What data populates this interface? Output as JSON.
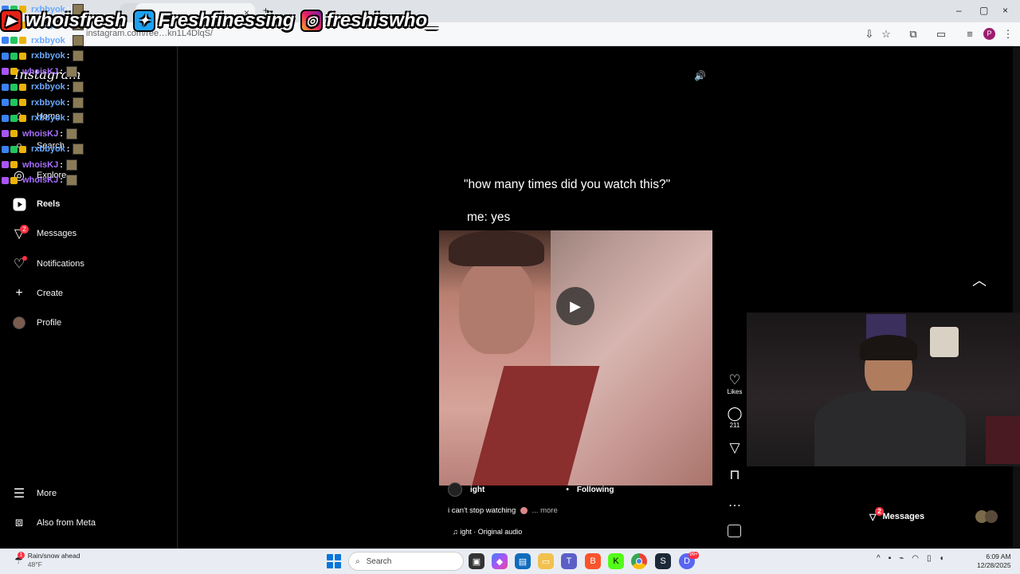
{
  "browser": {
    "tab_close": "×",
    "new_tab": "+",
    "url": "instagram.com/ree…kn1L4DlqS/",
    "window_controls": [
      "–",
      "▢",
      "×"
    ]
  },
  "overlay": {
    "socials": [
      {
        "icon": "youtube-icon",
        "handle": "whoisfresh"
      },
      {
        "icon": "twitter-icon",
        "handle": "Freshfinessing"
      },
      {
        "icon": "instagram-icon",
        "handle": "freshiswho_"
      }
    ],
    "chat": [
      {
        "name": "rxbbyok",
        "color": "blue"
      },
      {
        "name": "rxbbyok",
        "color": "blue"
      },
      {
        "name": "rxbbyok",
        "color": "blue"
      },
      {
        "name": "rxbbyok",
        "color": "blue"
      },
      {
        "name": "whoisKJ",
        "color": "purple"
      },
      {
        "name": "rxbbyok",
        "color": "blue"
      },
      {
        "name": "rxbbyok",
        "color": "blue"
      },
      {
        "name": "rxbbyok",
        "color": "blue"
      },
      {
        "name": "whoisKJ",
        "color": "purple"
      },
      {
        "name": "rxbbyok",
        "color": "blue"
      },
      {
        "name": "whoisKJ",
        "color": "purple"
      },
      {
        "name": "whoisKJ",
        "color": "purple"
      }
    ],
    "chat_colon": ":"
  },
  "sidebar": {
    "logo": "Instagram",
    "items": [
      {
        "label": "Home",
        "icon": "home-icon"
      },
      {
        "label": "Search",
        "icon": "search-icon"
      },
      {
        "label": "Explore",
        "icon": "compass-icon"
      },
      {
        "label": "Reels",
        "icon": "reels-icon"
      },
      {
        "label": "Messages",
        "icon": "messages-icon",
        "badge": "2"
      },
      {
        "label": "Notifications",
        "icon": "heart-icon"
      },
      {
        "label": "Create",
        "icon": "plus-icon"
      },
      {
        "label": "Profile",
        "icon": "avatar"
      }
    ],
    "bottom": [
      {
        "label": "More",
        "icon": "menu-icon"
      },
      {
        "label": "Also from Meta",
        "icon": "meta-icon"
      }
    ]
  },
  "reel": {
    "text_line1": "\"how many times did you watch this?\"",
    "text_line2": "me: yes",
    "author": "ight",
    "dot": "•",
    "following": "Following",
    "description": "i can't stop watching",
    "more": "... more",
    "audio": "ight · Original audio",
    "actions": {
      "likes": "Likes",
      "comments": "211"
    }
  },
  "messages_pill": {
    "label": "Messages",
    "badge": "2"
  },
  "taskbar": {
    "weather_title": "Rain/snow ahead",
    "weather_temp": "48°F",
    "weather_badge": "1",
    "search_placeholder": "Search",
    "time": "6:09 AM",
    "date": "12/28/2025",
    "app_badge": "99+"
  }
}
